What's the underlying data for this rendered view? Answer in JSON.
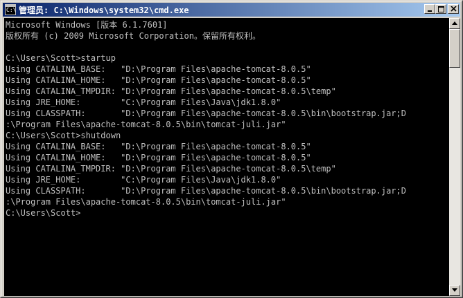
{
  "window": {
    "title": "管理员: C:\\Windows\\system32\\cmd.exe",
    "icon_text": "C:\\",
    "icons": {
      "app": "cmd-icon",
      "minimize": "minimize-icon",
      "maximize": "maximize-icon",
      "close": "close-icon",
      "scroll_up": "arrow-up-icon",
      "scroll_down": "arrow-down-icon"
    }
  },
  "console": {
    "colors": {
      "background": "#000000",
      "foreground": "#c0c0c0"
    },
    "lines": [
      "Microsoft Windows [版本 6.1.7601]",
      "版权所有 (c) 2009 Microsoft Corporation。保留所有权利。",
      "",
      "C:\\Users\\Scott>startup",
      "Using CATALINA_BASE:   \"D:\\Program Files\\apache-tomcat-8.0.5\"",
      "Using CATALINA_HOME:   \"D:\\Program Files\\apache-tomcat-8.0.5\"",
      "Using CATALINA_TMPDIR: \"D:\\Program Files\\apache-tomcat-8.0.5\\temp\"",
      "Using JRE_HOME:        \"C:\\Program Files\\Java\\jdk1.8.0\"",
      "Using CLASSPATH:       \"D:\\Program Files\\apache-tomcat-8.0.5\\bin\\bootstrap.jar;D",
      ":\\Program Files\\apache-tomcat-8.0.5\\bin\\tomcat-juli.jar\"",
      "C:\\Users\\Scott>shutdown",
      "Using CATALINA_BASE:   \"D:\\Program Files\\apache-tomcat-8.0.5\"",
      "Using CATALINA_HOME:   \"D:\\Program Files\\apache-tomcat-8.0.5\"",
      "Using CATALINA_TMPDIR: \"D:\\Program Files\\apache-tomcat-8.0.5\\temp\"",
      "Using JRE_HOME:        \"C:\\Program Files\\Java\\jdk1.8.0\"",
      "Using CLASSPATH:       \"D:\\Program Files\\apache-tomcat-8.0.5\\bin\\bootstrap.jar;D",
      ":\\Program Files\\apache-tomcat-8.0.5\\bin\\tomcat-juli.jar\"",
      "C:\\Users\\Scott>"
    ]
  }
}
